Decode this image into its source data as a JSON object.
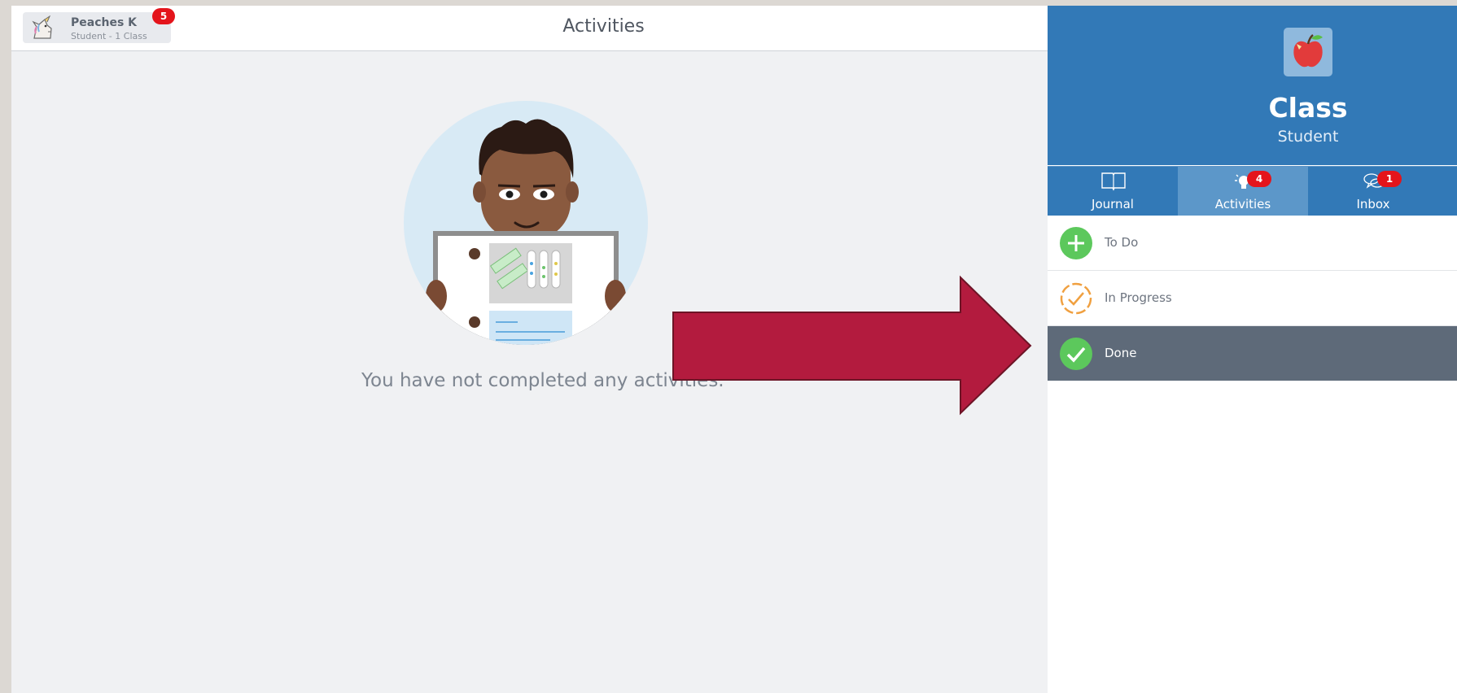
{
  "header": {
    "user_name": "Peaches K",
    "user_sub": "Student - 1 Class",
    "notification_count": "5",
    "page_title": "Activities"
  },
  "main": {
    "empty_message": "You have not completed any activities."
  },
  "sidebar": {
    "class_title": "Class",
    "class_subtitle": "Student",
    "tabs": [
      {
        "label": "Journal",
        "icon": "book-icon",
        "badge": null
      },
      {
        "label": "Activities",
        "icon": "lightbulb-icon",
        "badge": "4"
      },
      {
        "label": "Inbox",
        "icon": "chat-bubbles-icon",
        "badge": "1"
      }
    ],
    "active_tab": "Activities",
    "statuses": [
      {
        "label": "To Do",
        "icon": "plus-circle-icon"
      },
      {
        "label": "In Progress",
        "icon": "dashed-check-circle-icon"
      },
      {
        "label": "Done",
        "icon": "check-circle-icon"
      }
    ],
    "selected_status": "Done"
  },
  "colors": {
    "sidebar_blue": "#3279b7",
    "active_tab": "#5c97c9",
    "selected_row": "#5e6a79",
    "badge_red": "#e4141b",
    "green": "#5cc85c",
    "orange": "#f0a040",
    "arrow": "#b31b3e"
  }
}
